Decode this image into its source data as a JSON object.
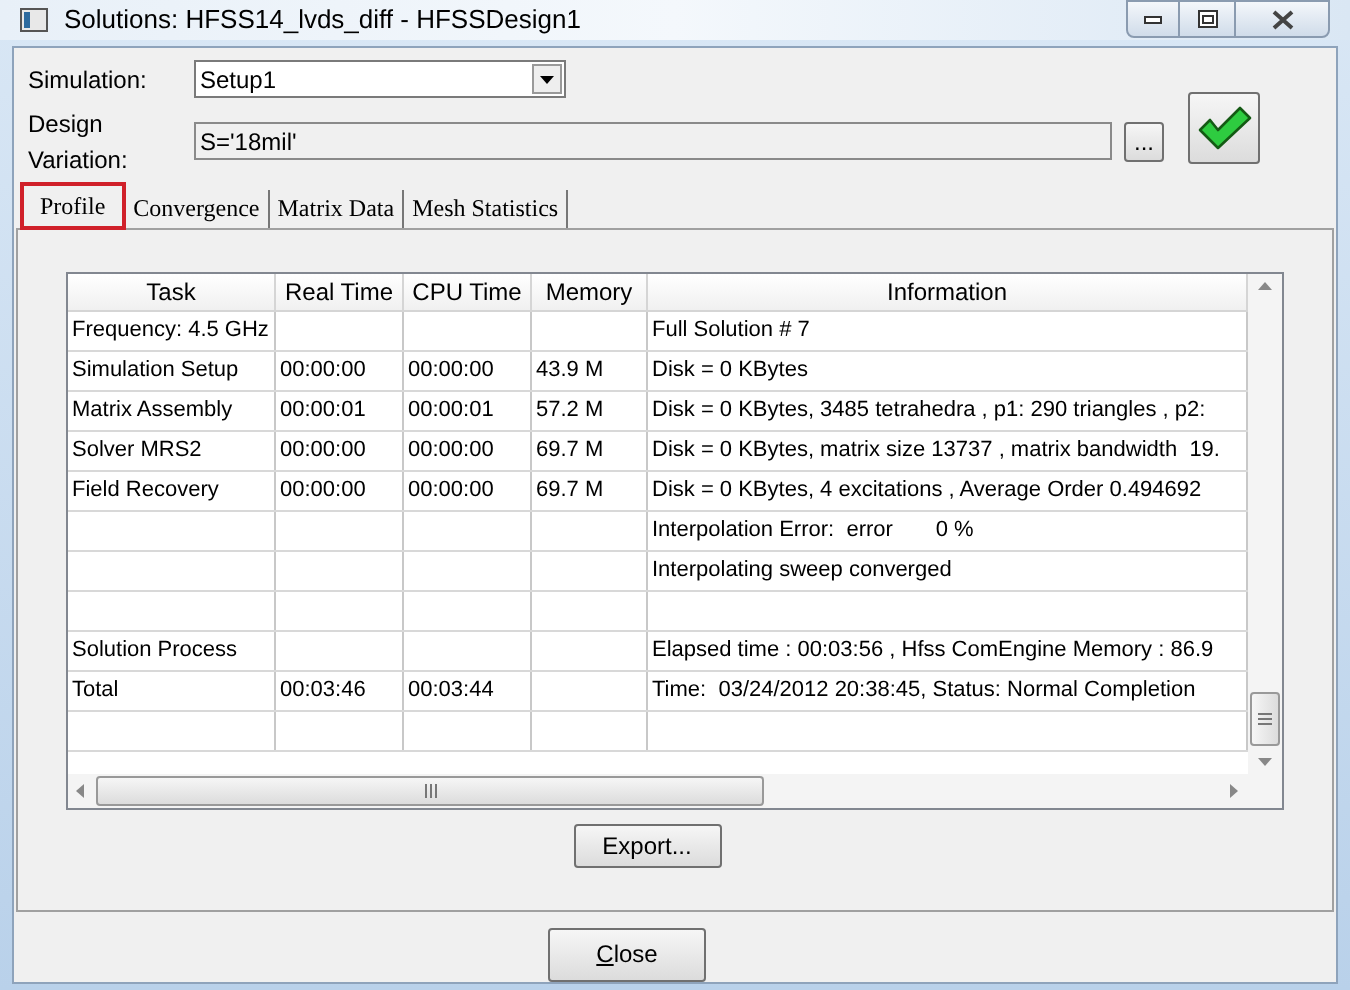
{
  "window": {
    "title": "Solutions: HFSS14_lvds_diff - HFSSDesign1"
  },
  "simulation": {
    "label": "Simulation:",
    "value": "Setup1"
  },
  "design_variation": {
    "label": "Design Variation:",
    "value": "S='18mil'",
    "browse_button": "..."
  },
  "tabs": [
    {
      "label": "Profile",
      "selected": true
    },
    {
      "label": "Convergence",
      "selected": false
    },
    {
      "label": "Matrix Data",
      "selected": false
    },
    {
      "label": "Mesh Statistics",
      "selected": false
    }
  ],
  "table": {
    "columns": [
      "Task",
      "Real Time",
      "CPU Time",
      "Memory",
      "Information"
    ],
    "rows": [
      {
        "task": "Frequency: 4.5 GHz",
        "information": "Full Solution # 7"
      },
      {
        "task": "Simulation Setup",
        "real_time": "00:00:00",
        "cpu_time": "00:00:00",
        "memory": "43.9 M",
        "information": "Disk = 0 KBytes"
      },
      {
        "task": "Matrix Assembly",
        "real_time": "00:00:01",
        "cpu_time": "00:00:01",
        "memory": "57.2 M",
        "information": "Disk = 0 KBytes, 3485 tetrahedra , p1: 290 triangles , p2:"
      },
      {
        "task": "Solver MRS2",
        "real_time": "00:00:00",
        "cpu_time": "00:00:00",
        "memory": "69.7 M",
        "information": "Disk = 0 KBytes, matrix size 13737 , matrix bandwidth  19."
      },
      {
        "task": "Field Recovery",
        "real_time": "00:00:00",
        "cpu_time": "00:00:00",
        "memory": "69.7 M",
        "information": "Disk = 0 KBytes, 4 excitations , Average Order 0.494692"
      },
      {
        "information": "Interpolation Error:  error       0 %"
      },
      {
        "information": "Interpolating sweep converged"
      },
      {},
      {
        "task": "Solution Process",
        "information": "Elapsed time : 00:03:56 , Hfss ComEngine Memory : 86.9"
      },
      {
        "task": "Total",
        "real_time": "00:03:46",
        "cpu_time": "00:03:44",
        "information": "Time:  03/24/2012 20:38:45, Status: Normal Completion"
      }
    ]
  },
  "export_button": "Export...",
  "close_button": "Close"
}
